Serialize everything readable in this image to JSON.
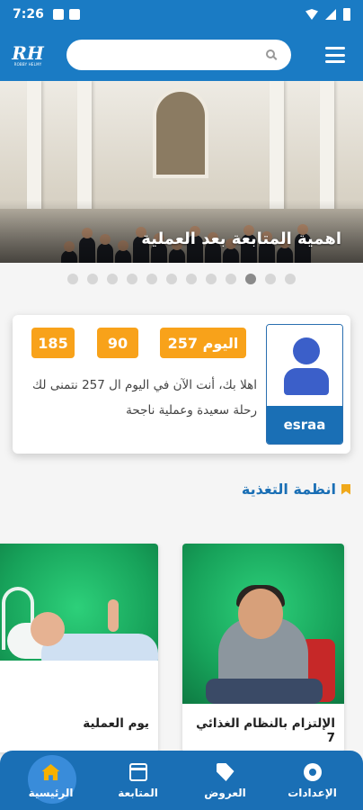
{
  "status_bar": {
    "time": "7:26"
  },
  "header": {
    "logo_mark": "RH",
    "logo_sub": "ROBBY HELMY",
    "search_placeholder": ""
  },
  "banner": {
    "caption": "اهمية المتابعة بعد العملية",
    "slide_count": 12,
    "active_slide": 9
  },
  "profile": {
    "name": "esraa",
    "day_badge": "اليوم 257",
    "stat_1": "90",
    "stat_2": "185",
    "message": "اهلا بك، أنت الآن في اليوم ال 257 نتمنى لك رحلة سعيدة وعملية ناجحة"
  },
  "section": {
    "title": "انظمة التغذية"
  },
  "articles": [
    {
      "title": "الإلتزام بالنظام الغذائي 7"
    },
    {
      "title": "يوم العملية"
    }
  ],
  "bottom_nav": {
    "items": [
      {
        "label": "الإعدادات",
        "icon": "gear-icon"
      },
      {
        "label": "العروض",
        "icon": "tag-icon"
      },
      {
        "label": "المتابعة",
        "icon": "calendar-icon"
      },
      {
        "label": "الرئيسية",
        "icon": "home-icon"
      }
    ],
    "active_index": 3
  },
  "colors": {
    "primary": "#1a7bc4",
    "accent": "#f8a21a",
    "nav": "#1a6fb5"
  }
}
